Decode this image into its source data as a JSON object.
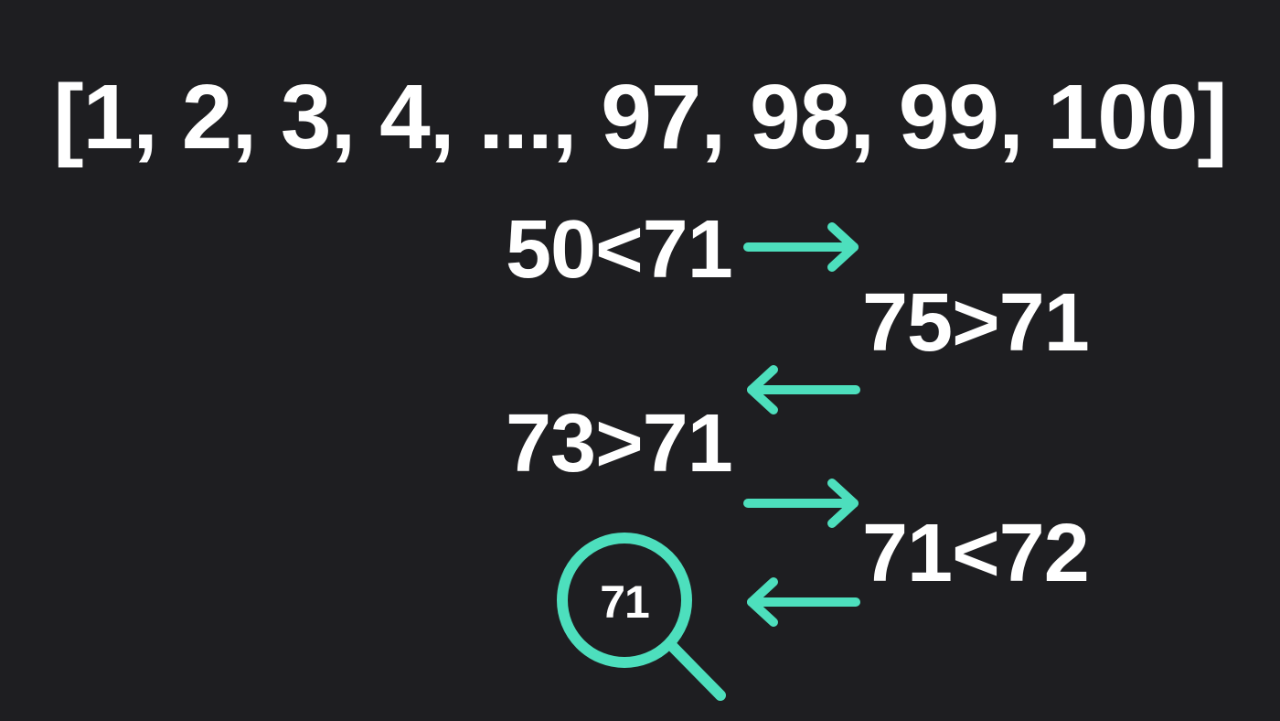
{
  "array_text": "[1, 2, 3, 4, ..., 97, 98, 99, 100]",
  "steps": [
    {
      "label": "50<71",
      "direction": "right"
    },
    {
      "label": "75>71",
      "direction": "left"
    },
    {
      "label": "73>71",
      "direction": "right"
    },
    {
      "label": "71<72",
      "direction": "left"
    }
  ],
  "found_value": "71",
  "colors": {
    "background": "#1e1e21",
    "text": "#ffffff",
    "accent": "#4ddfbd"
  },
  "icons": {
    "right_arrow": "arrow-right-icon",
    "left_arrow": "arrow-left-icon",
    "search": "magnifying-glass-icon"
  }
}
